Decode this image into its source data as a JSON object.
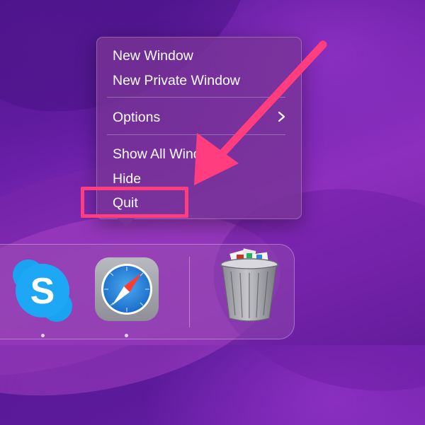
{
  "context_menu": {
    "items": [
      {
        "label": "New Window"
      },
      {
        "label": "New Private Window"
      },
      {
        "label": "Options"
      },
      {
        "label": "Show All Windows"
      },
      {
        "label": "Hide"
      },
      {
        "label": "Quit"
      }
    ]
  },
  "annotation": {
    "color": "#ff3d7f",
    "target": "Quit"
  },
  "dock": {
    "apps": [
      {
        "icon": "skype-icon",
        "running": true
      },
      {
        "icon": "safari-icon",
        "running": true
      },
      {
        "icon": "trash-icon",
        "running": false
      }
    ]
  }
}
